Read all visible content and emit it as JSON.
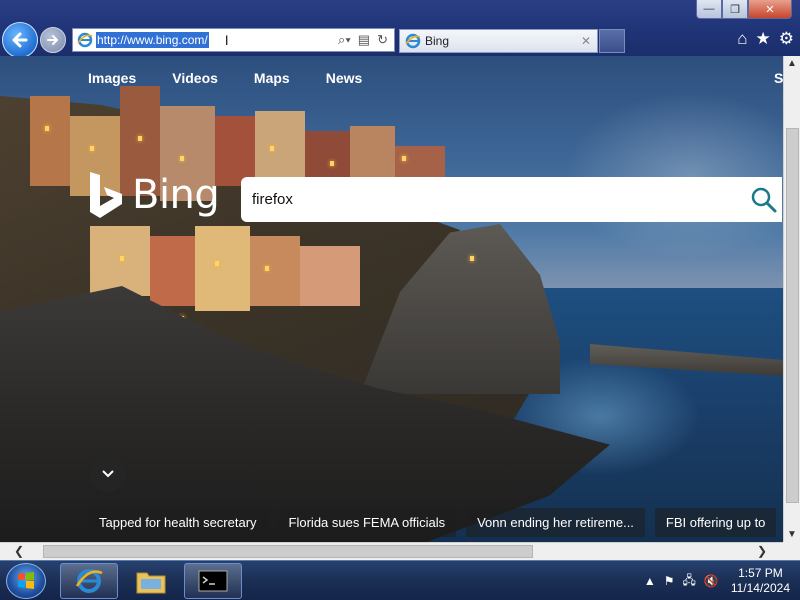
{
  "browser": {
    "address_url": "http://www.bing.com/",
    "tab_label": "Bing",
    "tab_close": "✕"
  },
  "window_controls": {
    "minimize": "—",
    "maximize": "❐",
    "close": "✕"
  },
  "toolbar": {
    "home": "⌂",
    "favorites": "★",
    "tools": "⚙"
  },
  "bing": {
    "nav": [
      "Images",
      "Videos",
      "Maps",
      "News"
    ],
    "nav_cut": "S",
    "logo_text": "Bing",
    "search_value": "firefox",
    "news": [
      "Tapped for health secretary",
      "Florida sues FEMA officials",
      "Vonn ending her retireme...",
      "FBI offering up to"
    ]
  },
  "taskbar": {
    "time": "1:57 PM",
    "date": "11/14/2024"
  },
  "colors": {
    "accent": "#1f6fd3",
    "search_icon": "#1a7a8a",
    "taskbar": "#1b2f55"
  }
}
